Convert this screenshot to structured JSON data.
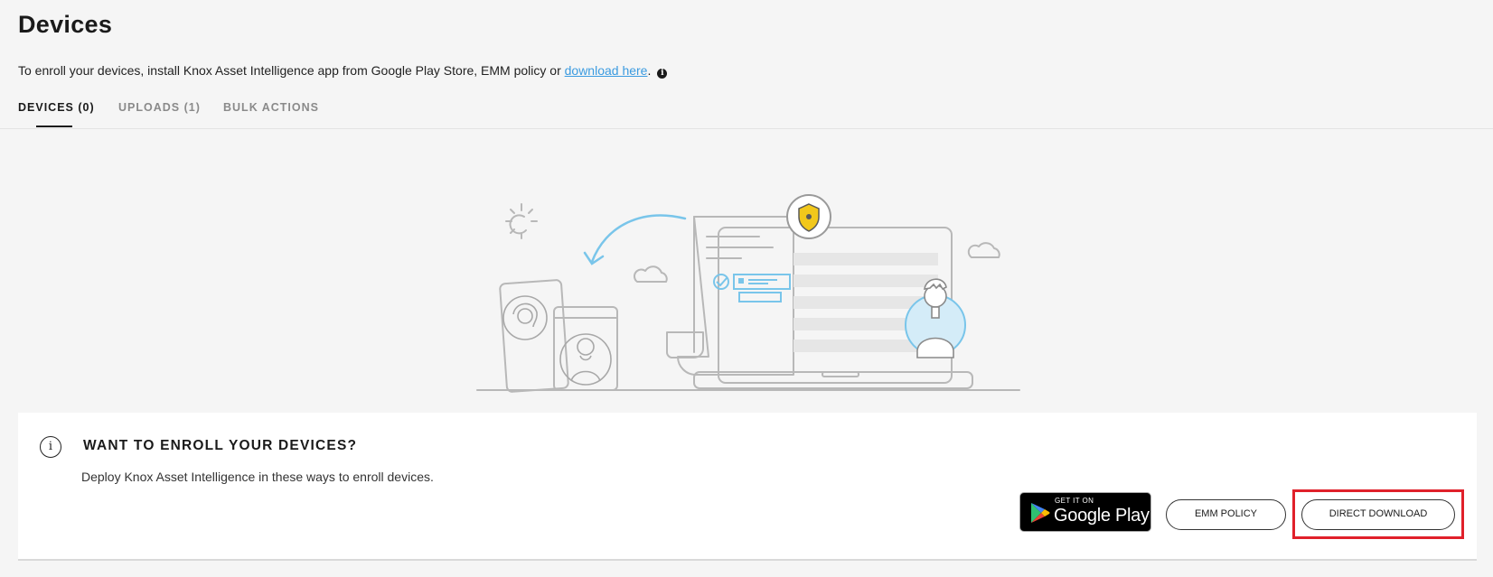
{
  "header": {
    "title": "Devices",
    "intro_prefix": "To enroll your devices, install Knox Asset Intelligence app from Google Play Store, EMM policy or ",
    "intro_link": "download here",
    "intro_suffix": ".",
    "info_glyph": "i"
  },
  "tabs": [
    {
      "label": "DEVICES (0)",
      "active": true
    },
    {
      "label": "UPLOADS (1)",
      "active": false
    },
    {
      "label": "BULK ACTIONS",
      "active": false
    }
  ],
  "enroll_card": {
    "info_glyph": "i",
    "title": "WANT TO ENROLL YOUR DEVICES?",
    "description": "Deploy Knox Asset Intelligence in these ways to enroll devices.",
    "google_play": {
      "small_text": "GET IT ON",
      "big_text": "Google Play"
    },
    "emm_button": "EMM POLICY",
    "direct_download_button": "DIRECT DOWNLOAD"
  },
  "colors": {
    "link": "#3b9be0",
    "highlight": "#e0202a",
    "illustration_accent": "#79c5ea",
    "shield": "#f2c81b"
  }
}
